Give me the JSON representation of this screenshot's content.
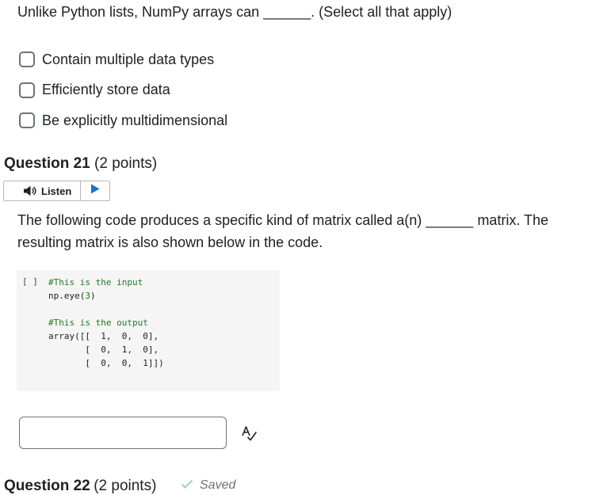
{
  "question_20": {
    "prompt": "Unlike Python lists, NumPy arrays can ______. (Select all that apply)",
    "options": [
      {
        "label": "Contain multiple data types",
        "checked": false
      },
      {
        "label": "Efficiently store data",
        "checked": false
      },
      {
        "label": "Be explicitly multidimensional",
        "checked": false
      }
    ]
  },
  "question_21": {
    "title": "Question 21",
    "points": "(2 points)",
    "listen_label": "Listen",
    "body": "The following code produces a specific kind of matrix called a(n) ______ matrix. The resulting matrix is also shown below in the code.",
    "code": {
      "gutter": "[ ]",
      "lines": [
        {
          "tokens": [
            {
              "t": "#This is the input",
              "c": "comment"
            }
          ]
        },
        {
          "tokens": [
            {
              "t": "np.eye(",
              "c": ""
            },
            {
              "t": "3",
              "c": "num"
            },
            {
              "t": ")",
              "c": ""
            }
          ]
        },
        {
          "tokens": []
        },
        {
          "tokens": [
            {
              "t": "#This is the output",
              "c": "comment"
            }
          ]
        },
        {
          "tokens": [
            {
              "t": "array([[  1,  0,  0],",
              "c": ""
            }
          ]
        },
        {
          "tokens": [
            {
              "t": "       [  0,  1,  0],",
              "c": ""
            }
          ]
        },
        {
          "tokens": [
            {
              "t": "       [  0,  0,  1]])",
              "c": ""
            }
          ]
        }
      ]
    },
    "answer_value": "",
    "spellcheck_icon": "spellcheck-icon"
  },
  "question_22": {
    "title": "Question 22",
    "points": "(2 points)",
    "saved_label": "Saved"
  },
  "colors": {
    "text": "#202122",
    "border": "#6e7376",
    "code_bg": "#f5f5f5",
    "code_comment": "#217a21",
    "saved_check": "#9fd6a8"
  }
}
